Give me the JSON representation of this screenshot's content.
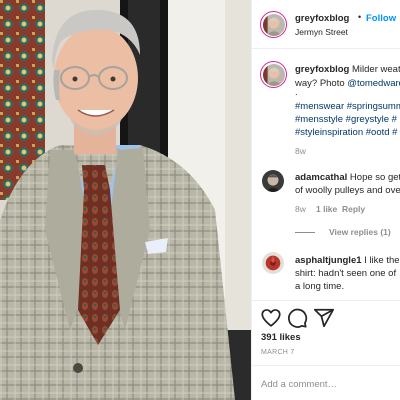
{
  "photo": {
    "alt_icon": "post-photo"
  },
  "header": {
    "username": "greyfoxblog",
    "separator": "•",
    "follow_label": "Follow",
    "location": "Jermyn Street"
  },
  "caption": {
    "username": "greyfoxblog",
    "line1_text": "Milder weat",
    "line2_text": "way? Photo ",
    "line2_mention": "@tomedward",
    "line3_text": ".",
    "line4_tags": "#menswear #springsumm",
    "line5_tags": "#mensstyle #greystyle #",
    "line6_tags": "#styleinspiration #ootd #",
    "time": "8w"
  },
  "comments": [
    {
      "username": "adamcathal",
      "line1_text": "Hope so get",
      "line2_text": "of woolly pulleys and ove",
      "time": "8w",
      "likes": "1 like",
      "reply_label": "Reply"
    },
    {
      "username": "asphaltjungle1",
      "line1_text": "I like the",
      "line2_text": "shirt: hadn't seen one of",
      "line3_text": "a long time."
    }
  ],
  "view_replies_label": "View replies (1)",
  "actions": {
    "like_icon": "heart-icon",
    "comment_icon": "comment-icon",
    "share_icon": "share-icon",
    "likes_count": "391 likes",
    "date": "MARCH 7"
  },
  "add_comment": {
    "placeholder": "Add a comment…"
  },
  "colors": {
    "link": "#0095f6",
    "tag": "#00376b",
    "muted": "#8e8e8e",
    "ring": "#d6249f"
  }
}
